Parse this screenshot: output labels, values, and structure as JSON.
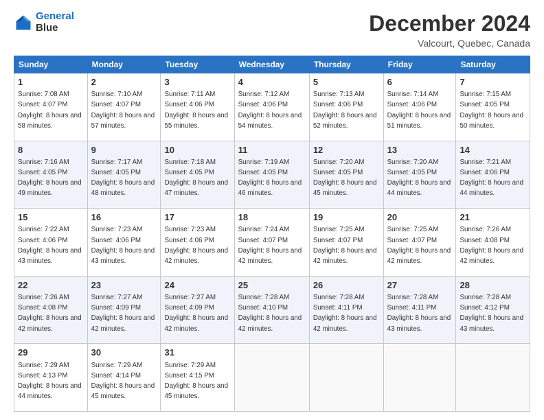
{
  "logo": {
    "line1": "General",
    "line2": "Blue"
  },
  "title": "December 2024",
  "subtitle": "Valcourt, Quebec, Canada",
  "weekdays": [
    "Sunday",
    "Monday",
    "Tuesday",
    "Wednesday",
    "Thursday",
    "Friday",
    "Saturday"
  ],
  "weeks": [
    [
      {
        "day": "1",
        "sunrise": "Sunrise: 7:08 AM",
        "sunset": "Sunset: 4:07 PM",
        "daylight": "Daylight: 8 hours and 58 minutes."
      },
      {
        "day": "2",
        "sunrise": "Sunrise: 7:10 AM",
        "sunset": "Sunset: 4:07 PM",
        "daylight": "Daylight: 8 hours and 57 minutes."
      },
      {
        "day": "3",
        "sunrise": "Sunrise: 7:11 AM",
        "sunset": "Sunset: 4:06 PM",
        "daylight": "Daylight: 8 hours and 55 minutes."
      },
      {
        "day": "4",
        "sunrise": "Sunrise: 7:12 AM",
        "sunset": "Sunset: 4:06 PM",
        "daylight": "Daylight: 8 hours and 54 minutes."
      },
      {
        "day": "5",
        "sunrise": "Sunrise: 7:13 AM",
        "sunset": "Sunset: 4:06 PM",
        "daylight": "Daylight: 8 hours and 52 minutes."
      },
      {
        "day": "6",
        "sunrise": "Sunrise: 7:14 AM",
        "sunset": "Sunset: 4:06 PM",
        "daylight": "Daylight: 8 hours and 51 minutes."
      },
      {
        "day": "7",
        "sunrise": "Sunrise: 7:15 AM",
        "sunset": "Sunset: 4:05 PM",
        "daylight": "Daylight: 8 hours and 50 minutes."
      }
    ],
    [
      {
        "day": "8",
        "sunrise": "Sunrise: 7:16 AM",
        "sunset": "Sunset: 4:05 PM",
        "daylight": "Daylight: 8 hours and 49 minutes."
      },
      {
        "day": "9",
        "sunrise": "Sunrise: 7:17 AM",
        "sunset": "Sunset: 4:05 PM",
        "daylight": "Daylight: 8 hours and 48 minutes."
      },
      {
        "day": "10",
        "sunrise": "Sunrise: 7:18 AM",
        "sunset": "Sunset: 4:05 PM",
        "daylight": "Daylight: 8 hours and 47 minutes."
      },
      {
        "day": "11",
        "sunrise": "Sunrise: 7:19 AM",
        "sunset": "Sunset: 4:05 PM",
        "daylight": "Daylight: 8 hours and 46 minutes."
      },
      {
        "day": "12",
        "sunrise": "Sunrise: 7:20 AM",
        "sunset": "Sunset: 4:05 PM",
        "daylight": "Daylight: 8 hours and 45 minutes."
      },
      {
        "day": "13",
        "sunrise": "Sunrise: 7:20 AM",
        "sunset": "Sunset: 4:05 PM",
        "daylight": "Daylight: 8 hours and 44 minutes."
      },
      {
        "day": "14",
        "sunrise": "Sunrise: 7:21 AM",
        "sunset": "Sunset: 4:06 PM",
        "daylight": "Daylight: 8 hours and 44 minutes."
      }
    ],
    [
      {
        "day": "15",
        "sunrise": "Sunrise: 7:22 AM",
        "sunset": "Sunset: 4:06 PM",
        "daylight": "Daylight: 8 hours and 43 minutes."
      },
      {
        "day": "16",
        "sunrise": "Sunrise: 7:23 AM",
        "sunset": "Sunset: 4:06 PM",
        "daylight": "Daylight: 8 hours and 43 minutes."
      },
      {
        "day": "17",
        "sunrise": "Sunrise: 7:23 AM",
        "sunset": "Sunset: 4:06 PM",
        "daylight": "Daylight: 8 hours and 42 minutes."
      },
      {
        "day": "18",
        "sunrise": "Sunrise: 7:24 AM",
        "sunset": "Sunset: 4:07 PM",
        "daylight": "Daylight: 8 hours and 42 minutes."
      },
      {
        "day": "19",
        "sunrise": "Sunrise: 7:25 AM",
        "sunset": "Sunset: 4:07 PM",
        "daylight": "Daylight: 8 hours and 42 minutes."
      },
      {
        "day": "20",
        "sunrise": "Sunrise: 7:25 AM",
        "sunset": "Sunset: 4:07 PM",
        "daylight": "Daylight: 8 hours and 42 minutes."
      },
      {
        "day": "21",
        "sunrise": "Sunrise: 7:26 AM",
        "sunset": "Sunset: 4:08 PM",
        "daylight": "Daylight: 8 hours and 42 minutes."
      }
    ],
    [
      {
        "day": "22",
        "sunrise": "Sunrise: 7:26 AM",
        "sunset": "Sunset: 4:08 PM",
        "daylight": "Daylight: 8 hours and 42 minutes."
      },
      {
        "day": "23",
        "sunrise": "Sunrise: 7:27 AM",
        "sunset": "Sunset: 4:09 PM",
        "daylight": "Daylight: 8 hours and 42 minutes."
      },
      {
        "day": "24",
        "sunrise": "Sunrise: 7:27 AM",
        "sunset": "Sunset: 4:09 PM",
        "daylight": "Daylight: 8 hours and 42 minutes."
      },
      {
        "day": "25",
        "sunrise": "Sunrise: 7:28 AM",
        "sunset": "Sunset: 4:10 PM",
        "daylight": "Daylight: 8 hours and 42 minutes."
      },
      {
        "day": "26",
        "sunrise": "Sunrise: 7:28 AM",
        "sunset": "Sunset: 4:11 PM",
        "daylight": "Daylight: 8 hours and 42 minutes."
      },
      {
        "day": "27",
        "sunrise": "Sunrise: 7:28 AM",
        "sunset": "Sunset: 4:11 PM",
        "daylight": "Daylight: 8 hours and 43 minutes."
      },
      {
        "day": "28",
        "sunrise": "Sunrise: 7:28 AM",
        "sunset": "Sunset: 4:12 PM",
        "daylight": "Daylight: 8 hours and 43 minutes."
      }
    ],
    [
      {
        "day": "29",
        "sunrise": "Sunrise: 7:29 AM",
        "sunset": "Sunset: 4:13 PM",
        "daylight": "Daylight: 8 hours and 44 minutes."
      },
      {
        "day": "30",
        "sunrise": "Sunrise: 7:29 AM",
        "sunset": "Sunset: 4:14 PM",
        "daylight": "Daylight: 8 hours and 45 minutes."
      },
      {
        "day": "31",
        "sunrise": "Sunrise: 7:29 AM",
        "sunset": "Sunset: 4:15 PM",
        "daylight": "Daylight: 8 hours and 45 minutes."
      },
      null,
      null,
      null,
      null
    ]
  ]
}
